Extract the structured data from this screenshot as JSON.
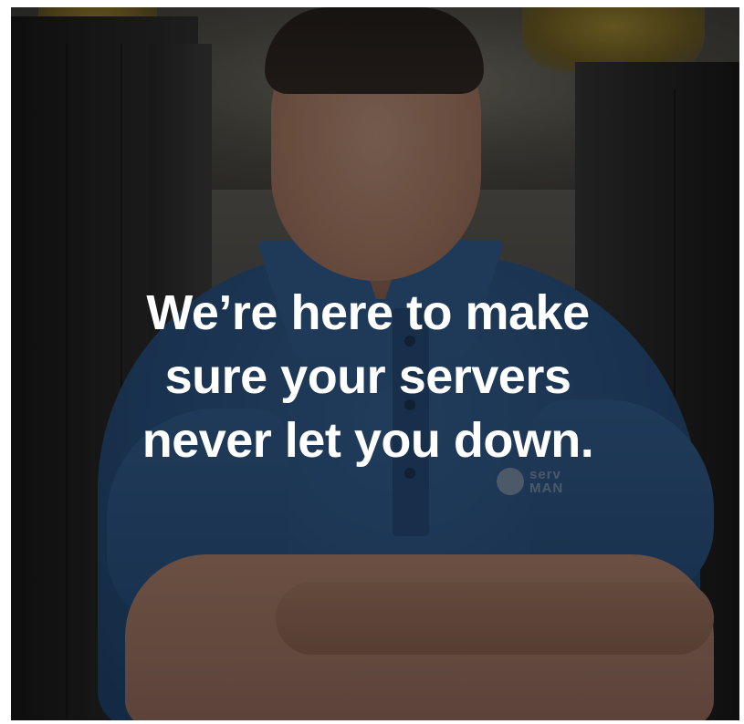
{
  "headline": {
    "line1": "We’re here to make",
    "line2": "sure your servers",
    "line3": "never let you down."
  },
  "shirt_logo": {
    "line1": "serv",
    "line2": "MAN"
  },
  "photo": {
    "subject": "person-icon",
    "shirt_color": "#2f5c91",
    "overlay_color": "#000000"
  }
}
